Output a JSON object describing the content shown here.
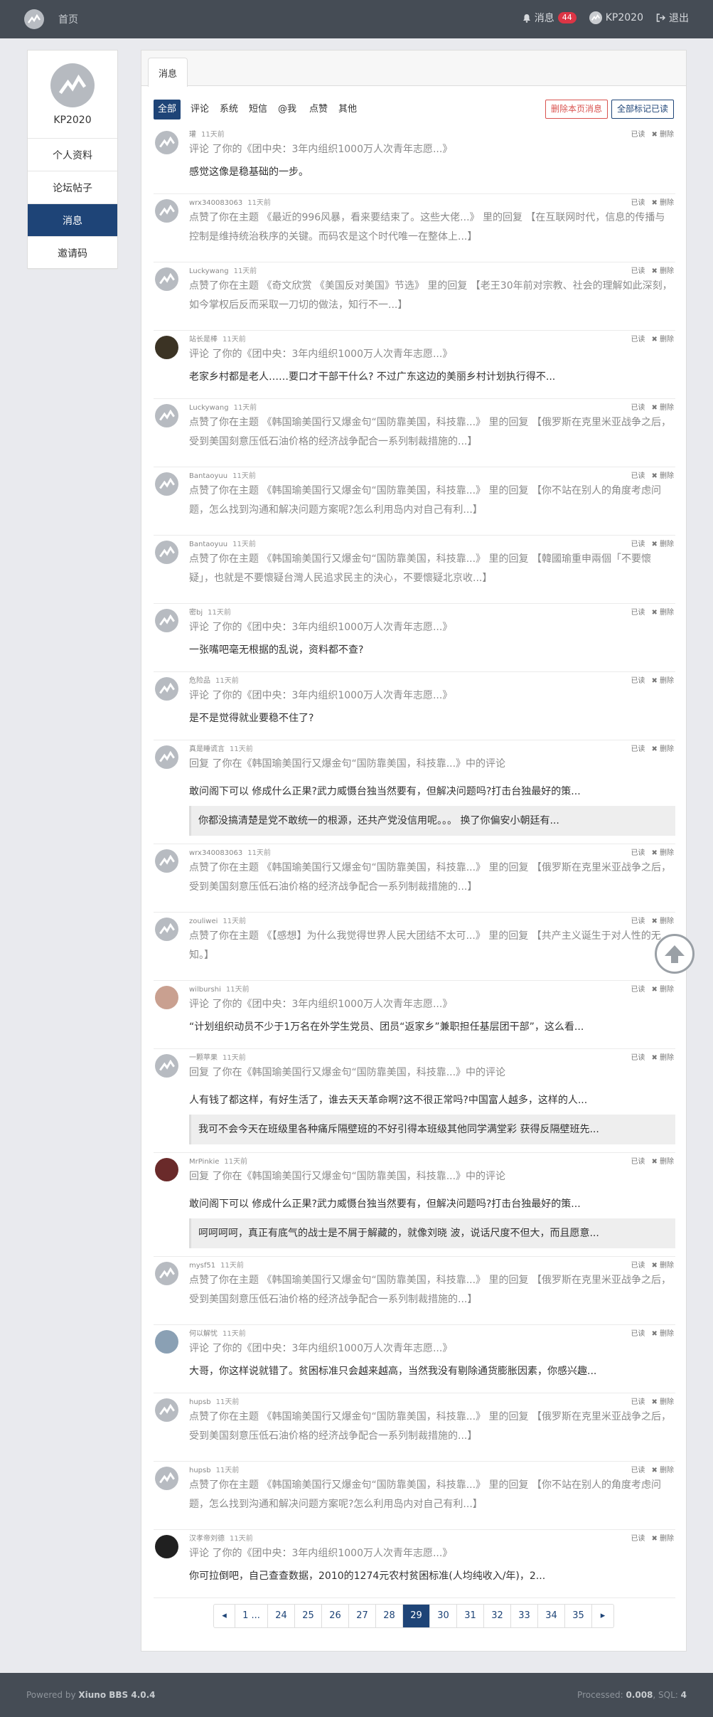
{
  "nav": {
    "home": "首页",
    "messages": "消息",
    "message_count": "44",
    "username": "KP2020",
    "logout": "退出"
  },
  "sidebar": {
    "username": "KP2020",
    "items": [
      {
        "label": "个人资料"
      },
      {
        "label": "论坛帖子"
      },
      {
        "label": "消息"
      },
      {
        "label": "邀请码"
      }
    ]
  },
  "main": {
    "tab": "消息",
    "filters": [
      "全部",
      "评论",
      "系统",
      "短信",
      "@我",
      "点赞",
      "其他"
    ],
    "delete_page": "删除本页消息",
    "mark_all_read": "全部标记已读",
    "read_label": "已读",
    "delete_label": "删除"
  },
  "messages": [
    {
      "user": "瓘",
      "time": "11天前",
      "line1": "评论 了你的《团中央：3年内组织1000万人次青年志愿...》",
      "line2": "感觉这像是稳基础的一步。"
    },
    {
      "user": "wrx340083063",
      "time": "11天前",
      "line1": "点赞了你在主题 《最近的996风暴，看来要结束了。这些大佬...》 里的回复 【在互联网时代，信息的传播与控制是维持统治秩序的关键。而码农是这个时代唯一在整体上...】"
    },
    {
      "user": "Luckywang",
      "time": "11天前",
      "line1": "点赞了你在主题 《奇文欣赏 《美国反对美国》节选》 里的回复 【老王30年前对宗教、社会的理解如此深刻，如今掌权后反而采取一刀切的做法，知行不一...】"
    },
    {
      "user": "站长是棒",
      "time": "11天前",
      "line1": "评论 了你的《团中央：3年内组织1000万人次青年志愿...》",
      "line2": "老家乡村都是老人……要口才干部干什么? 不过广东这边的美丽乡村计划执行得不..."
    },
    {
      "user": "Luckywang",
      "time": "11天前",
      "line1": "点赞了你在主题 《韩国瑜美国行又爆金句“国防靠美国，科技靠...》 里的回复 【俄罗斯在克里米亚战争之后，受到美国刻意压低石油价格的经济战争配合一系列制裁措施的...】"
    },
    {
      "user": "Bantaoyuu",
      "time": "11天前",
      "line1": "点赞了你在主题 《韩国瑜美国行又爆金句“国防靠美国，科技靠...》 里的回复 【你不站在别人的角度考虑问题，怎么找到沟通和解决问题方案呢?怎么利用岛内对自己有利...】"
    },
    {
      "user": "Bantaoyuu",
      "time": "11天前",
      "line1": "点赞了你在主题 《韩国瑜美国行又爆金句“国防靠美国，科技靠...》 里的回复 【韓國瑜重申兩個「不要懷疑」，也就是不要懷疑台灣人民追求民主的決心，不要懷疑北京收...】"
    },
    {
      "user": "密bj",
      "time": "11天前",
      "line1": "评论 了你的《团中央：3年内组织1000万人次青年志愿...》",
      "line2": "一张嘴吧毫无根据的乱说，资料都不查?"
    },
    {
      "user": "危险品",
      "time": "11天前",
      "line1": "评论 了你的《团中央：3年内组织1000万人次青年志愿...》",
      "line2": "是不是觉得就业要稳不住了?"
    },
    {
      "user": "真是睡谎言",
      "time": "11天前",
      "line1": "回复 了你在《韩国瑜美国行又爆金句“国防靠美国，科技靠...》中的评论",
      "line2": "敢问阁下可以 修成什么正果?武力威慑台独当然要有，但解决问题吗?打击台独最好的策...",
      "quote": "你都没搞清楚是党不敢统一的根源，还共产党没信用呢。。。 换了你偏安小朝廷有..."
    },
    {
      "user": "wrx340083063",
      "time": "11天前",
      "line1": "点赞了你在主题 《韩国瑜美国行又爆金句“国防靠美国，科技靠...》 里的回复 【俄罗斯在克里米亚战争之后，受到美国刻意压低石油价格的经济战争配合一系列制裁措施的...】"
    },
    {
      "user": "zouliwei",
      "time": "11天前",
      "line1": "点赞了你在主题 《【感想】为什么我觉得世界人民大团结不太可...》 里的回复 【共产主义诞生于对人性的无知。】"
    },
    {
      "user": "wilburshi",
      "time": "11天前",
      "line1": "评论 了你的《团中央：3年内组织1000万人次青年志愿...》",
      "line2": "“计划组织动员不少于1万名在外学生党员、团员“返家乡”兼职担任基层团干部”，这么看..."
    },
    {
      "user": "一颗苹果",
      "time": "11天前",
      "line1": "回复 了你在《韩国瑜美国行又爆金句“国防靠美国，科技靠...》中的评论",
      "line2": "人有钱了都这样，有好生活了，谁去天天革命啊?这不很正常吗?中国富人越多，这样的人...",
      "quote": "我可不会今天在班级里各种痛斥隔壁班的不好引得本班级其他同学满堂彩 获得反隔壁班先..."
    },
    {
      "user": "MrPinkie",
      "time": "11天前",
      "line1": "回复 了你在《韩国瑜美国行又爆金句“国防靠美国，科技靠...》中的评论",
      "line2": "敢问阁下可以 修成什么正果?武力威慑台独当然要有，但解决问题吗?打击台独最好的策...",
      "quote": "呵呵呵呵，真正有底气的战士是不屑于解藏的，就像刘晓 波，说话尺度不但大，而且愿意..."
    },
    {
      "user": "mysf51",
      "time": "11天前",
      "line1": "点赞了你在主题 《韩国瑜美国行又爆金句“国防靠美国，科技靠...》 里的回复 【俄罗斯在克里米亚战争之后，受到美国刻意压低石油价格的经济战争配合一系列制裁措施的...】"
    },
    {
      "user": "何以解忧",
      "time": "11天前",
      "line1": "评论 了你的《团中央：3年内组织1000万人次青年志愿...》",
      "line2": "大哥，你这样说就错了。贫困标准只会越来越高，当然我没有剔除通货膨胀因素，你感兴趣..."
    },
    {
      "user": "hupsb",
      "time": "11天前",
      "line1": "点赞了你在主题 《韩国瑜美国行又爆金句“国防靠美国，科技靠...》 里的回复 【俄罗斯在克里米亚战争之后，受到美国刻意压低石油价格的经济战争配合一系列制裁措施的...】"
    },
    {
      "user": "hupsb",
      "time": "11天前",
      "line1": "点赞了你在主题 《韩国瑜美国行又爆金句“国防靠美国，科技靠...》 里的回复 【你不站在别人的角度考虑问题，怎么找到沟通和解决问题方案呢?怎么利用岛内对自己有利...】"
    },
    {
      "user": "汉孝帝刘德",
      "time": "11天前",
      "line1": "评论 了你的《团中央：3年内组织1000万人次青年志愿...》",
      "line2": "你可拉倒吧，自己查查数据，2010的1274元农村贫困标准(人均纯收入/年)，2..."
    }
  ],
  "pagination": {
    "prev": "◂",
    "pages": [
      "1 ...",
      "24",
      "25",
      "26",
      "27",
      "28",
      "29",
      "30",
      "31",
      "32",
      "33",
      "34",
      "35"
    ],
    "current": "29",
    "next": "▸"
  },
  "footer": {
    "powered_prefix": "Powered by ",
    "powered_name": "Xiuno BBS 4.0.4",
    "processed_label": "Processed: ",
    "processed_value": "0.008",
    "sql_label": ", SQL: ",
    "sql_value": "4"
  },
  "colors": {
    "navbar": "#454c55",
    "accent": "#1e4477",
    "danger": "#dc3545"
  }
}
